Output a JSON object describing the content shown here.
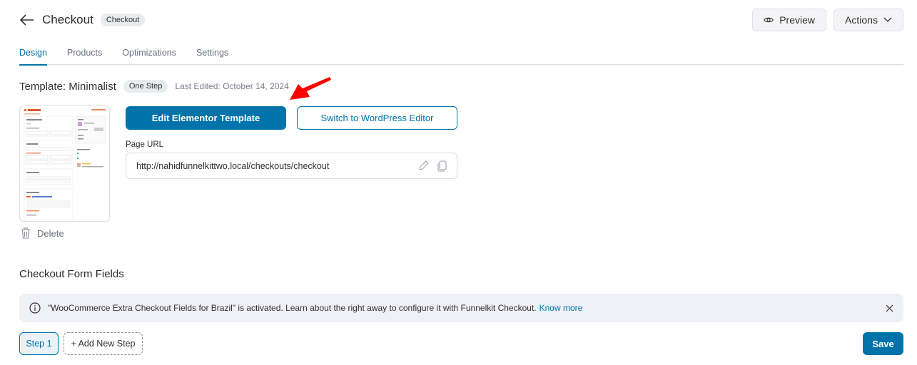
{
  "header": {
    "title": "Checkout",
    "type_badge": "Checkout",
    "preview_label": "Preview",
    "actions_label": "Actions"
  },
  "tabs": [
    {
      "label": "Design",
      "active": true
    },
    {
      "label": "Products",
      "active": false
    },
    {
      "label": "Optimizations",
      "active": false
    },
    {
      "label": "Settings",
      "active": false
    }
  ],
  "template": {
    "title": "Template: Minimalist",
    "step_badge": "One Step",
    "last_edited": "Last Edited: October 14, 2024",
    "delete_label": "Delete",
    "edit_button": "Edit Elementor Template",
    "switch_button": "Switch to WordPress Editor",
    "url_label": "Page URL",
    "url_value": "http://nahidfunnelkittwo.local/checkouts/checkout"
  },
  "form_fields": {
    "title": "Checkout Form Fields",
    "notice_text": "\"WooCommerce Extra Checkout Fields for Brazil\" is activated. Learn about the right away to configure it with Funnelkit Checkout.",
    "notice_link": "Know more",
    "steps": [
      {
        "label": "Step 1",
        "active": true
      }
    ],
    "add_step_label": "+ Add New Step",
    "save_label": "Save"
  },
  "colors": {
    "accent": "#0073aa",
    "annotation_arrow": "#ff0000",
    "notice_bg": "#f0f0f7"
  }
}
